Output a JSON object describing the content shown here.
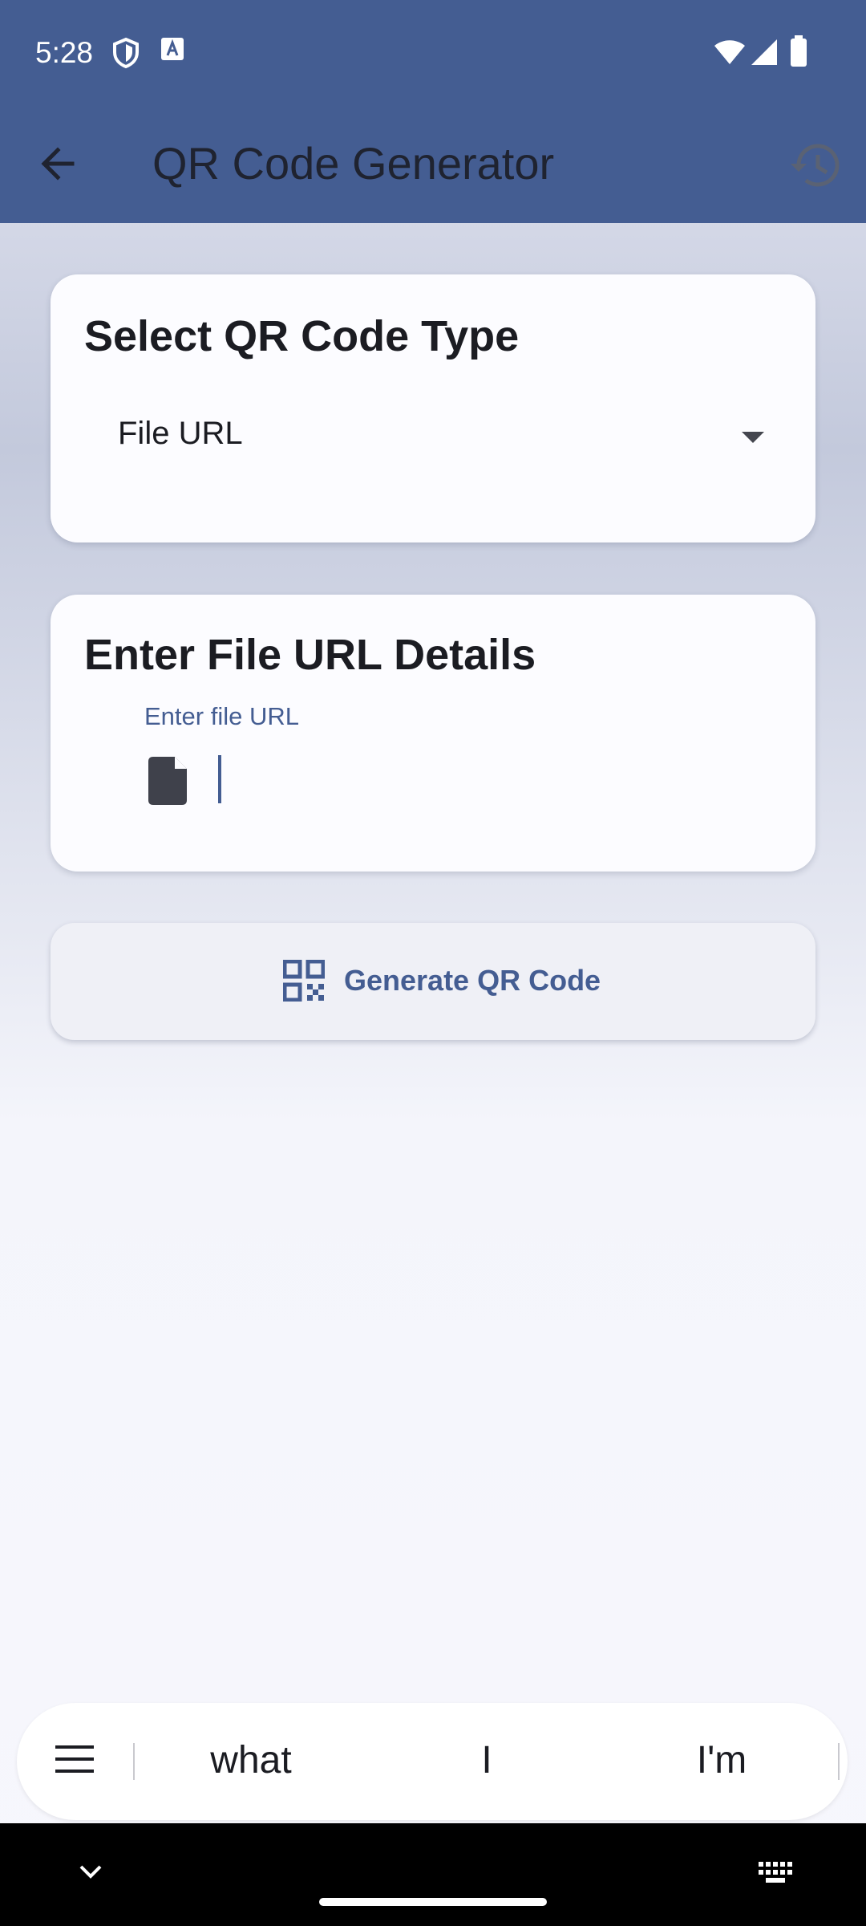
{
  "status_bar": {
    "time": "5:28",
    "icons": [
      "shield-icon",
      "text-a-icon",
      "wifi-icon",
      "signal-icon",
      "battery-icon"
    ]
  },
  "app_bar": {
    "title": "QR Code Generator",
    "back_icon": "back-arrow-icon",
    "history_icon": "history-icon"
  },
  "type_card": {
    "title": "Select QR Code Type",
    "selected_type": "File URL"
  },
  "details_card": {
    "title": "Enter File URL Details",
    "field_label": "Enter file URL",
    "field_value": ""
  },
  "generate_button": {
    "label": "Generate QR Code",
    "icon": "qr-code-icon"
  },
  "keyboard": {
    "suggestions": [
      "what",
      "I",
      "I'm"
    ]
  },
  "colors": {
    "primary": "#445d92",
    "card_bg": "#fcfcff",
    "text_dark": "#1b1c22"
  }
}
